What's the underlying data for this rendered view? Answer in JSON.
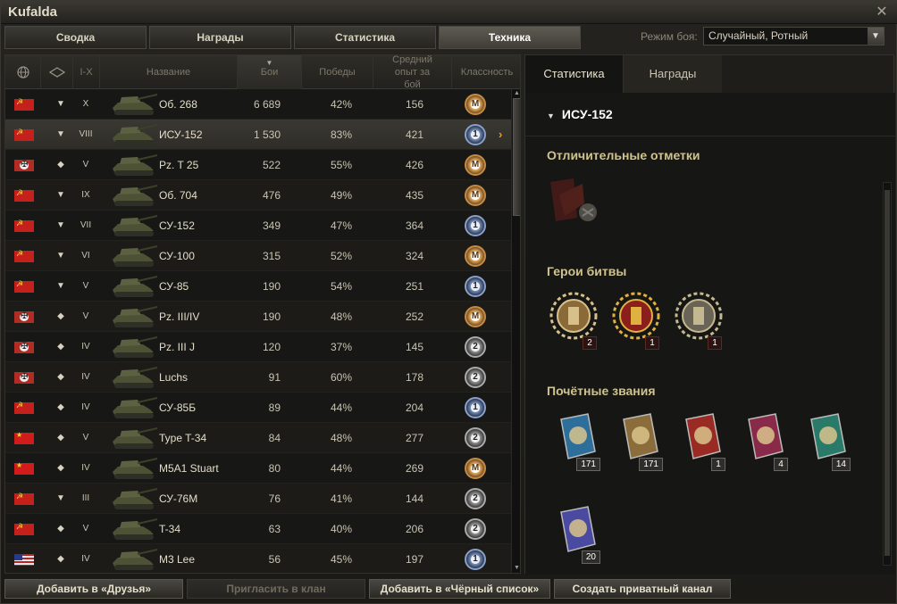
{
  "window": {
    "title": "Kufalda"
  },
  "tabs": [
    {
      "label": "Сводка"
    },
    {
      "label": "Награды"
    },
    {
      "label": "Статистика"
    },
    {
      "label": "Техника"
    }
  ],
  "mode": {
    "label": "Режим боя:",
    "value": "Случайный, Ротный"
  },
  "table": {
    "headers": {
      "tier": "I-X",
      "name": "Название",
      "battles": "Бои",
      "wins": "Победы",
      "xp": "Средний опыт за бой",
      "mastery": "Классность"
    },
    "rows": [
      {
        "nation": "ussr",
        "type": "▼",
        "tier": "X",
        "name": "Об. 268",
        "battles": "6 689",
        "wins": "42%",
        "xp": "156",
        "mastery": "M",
        "mclass": "m"
      },
      {
        "nation": "ussr",
        "type": "▼",
        "tier": "VIII",
        "name": "ИСУ-152",
        "battles": "1 530",
        "wins": "83%",
        "xp": "421",
        "mastery": "1",
        "mclass": "c1",
        "selected": true
      },
      {
        "nation": "ger",
        "type": "◆",
        "tier": "V",
        "name": "Pz. T 25",
        "battles": "522",
        "wins": "55%",
        "xp": "426",
        "mastery": "M",
        "mclass": "m"
      },
      {
        "nation": "ussr",
        "type": "▼",
        "tier": "IX",
        "name": "Об. 704",
        "battles": "476",
        "wins": "49%",
        "xp": "435",
        "mastery": "M",
        "mclass": "m"
      },
      {
        "nation": "ussr",
        "type": "▼",
        "tier": "VII",
        "name": "СУ-152",
        "battles": "349",
        "wins": "47%",
        "xp": "364",
        "mastery": "1",
        "mclass": "c1"
      },
      {
        "nation": "ussr",
        "type": "▼",
        "tier": "VI",
        "name": "СУ-100",
        "battles": "315",
        "wins": "52%",
        "xp": "324",
        "mastery": "M",
        "mclass": "m"
      },
      {
        "nation": "ussr",
        "type": "▼",
        "tier": "V",
        "name": "СУ-85",
        "battles": "190",
        "wins": "54%",
        "xp": "251",
        "mastery": "1",
        "mclass": "c1"
      },
      {
        "nation": "ger",
        "type": "◆",
        "tier": "V",
        "name": "Pz. III/IV",
        "battles": "190",
        "wins": "48%",
        "xp": "252",
        "mastery": "M",
        "mclass": "m"
      },
      {
        "nation": "ger",
        "type": "◆",
        "tier": "IV",
        "name": "Pz. III J",
        "battles": "120",
        "wins": "37%",
        "xp": "145",
        "mastery": "2",
        "mclass": "c2"
      },
      {
        "nation": "ger",
        "type": "◆",
        "tier": "IV",
        "name": "Luchs",
        "battles": "91",
        "wins": "60%",
        "xp": "178",
        "mastery": "2",
        "mclass": "c2"
      },
      {
        "nation": "ussr",
        "type": "◆",
        "tier": "IV",
        "name": "СУ-85Б",
        "battles": "89",
        "wins": "44%",
        "xp": "204",
        "mastery": "1",
        "mclass": "c1"
      },
      {
        "nation": "china",
        "type": "◆",
        "tier": "V",
        "name": "Type T-34",
        "battles": "84",
        "wins": "48%",
        "xp": "277",
        "mastery": "2",
        "mclass": "c2"
      },
      {
        "nation": "china",
        "type": "◆",
        "tier": "IV",
        "name": "M5A1 Stuart",
        "battles": "80",
        "wins": "44%",
        "xp": "269",
        "mastery": "M",
        "mclass": "m"
      },
      {
        "nation": "ussr",
        "type": "▼",
        "tier": "III",
        "name": "СУ-76М",
        "battles": "76",
        "wins": "41%",
        "xp": "144",
        "mastery": "2",
        "mclass": "c2"
      },
      {
        "nation": "ussr",
        "type": "◆",
        "tier": "V",
        "name": "T-34",
        "battles": "63",
        "wins": "40%",
        "xp": "206",
        "mastery": "2",
        "mclass": "c2"
      },
      {
        "nation": "usa",
        "type": "◆",
        "tier": "IV",
        "name": "M3 Lee",
        "battles": "56",
        "wins": "45%",
        "xp": "197",
        "mastery": "1",
        "mclass": "c1"
      }
    ]
  },
  "right": {
    "tabs": [
      {
        "label": "Статистика"
      },
      {
        "label": "Награды"
      }
    ],
    "vehicle": "ИСУ-152",
    "sections": {
      "marks": "Отличительные отметки",
      "heroes": "Герои битвы",
      "honors": "Почётные звания"
    },
    "heroes": [
      {
        "icon": "top-gun-medal-icon",
        "count": "2"
      },
      {
        "icon": "defender-medal-icon",
        "count": "1"
      },
      {
        "icon": "tank-medal-icon",
        "count": "1"
      }
    ],
    "honors": [
      {
        "icon": "medic-ribbon-icon",
        "count": "171"
      },
      {
        "icon": "armor-ribbon-icon",
        "count": "171"
      },
      {
        "icon": "red-ribbon-icon",
        "count": "1"
      },
      {
        "icon": "shell-ribbon-icon",
        "count": "4"
      },
      {
        "icon": "green-ribbon-icon",
        "count": "14"
      },
      {
        "icon": "purple-ribbon-icon",
        "count": "20"
      }
    ]
  },
  "buttons": {
    "friends": "Добавить в «Друзья»",
    "clan": "Пригласить в клан",
    "blacklist": "Добавить в «Чёрный список»",
    "private": "Создать приватный канал"
  }
}
